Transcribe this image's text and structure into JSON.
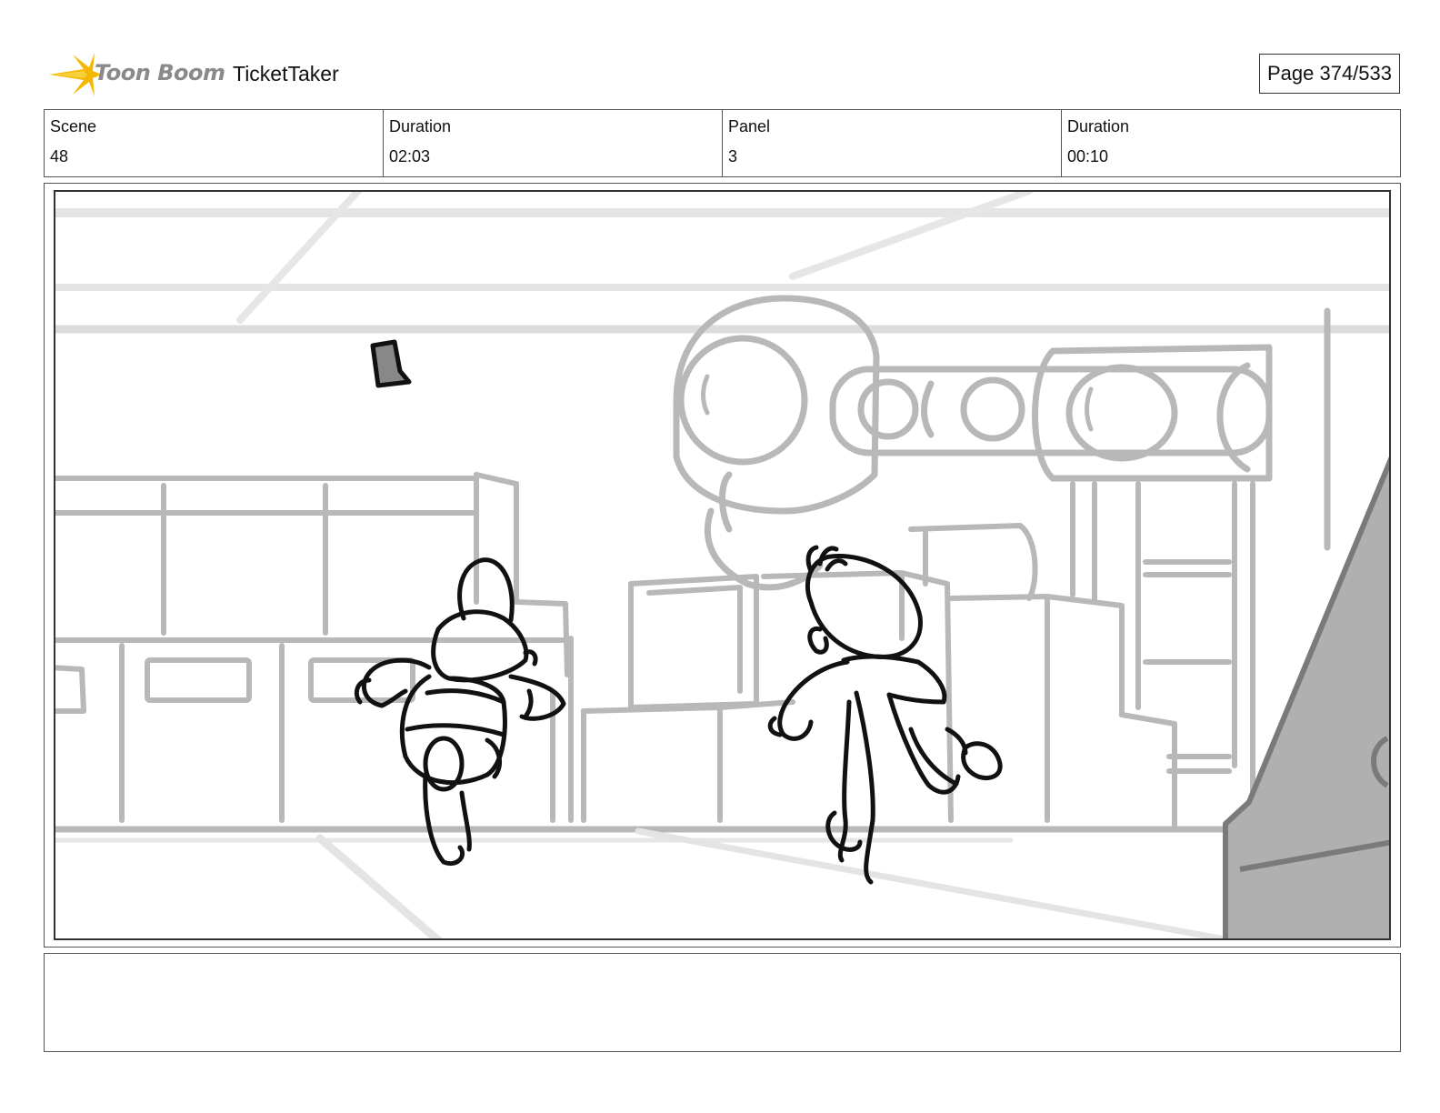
{
  "header": {
    "logo_text": "Toon Boom",
    "project_title": "TicketTaker",
    "page_label": "Page 374/533"
  },
  "info": {
    "scene_label": "Scene",
    "scene_value": "48",
    "scene_duration_label": "Duration",
    "scene_duration_value": "02:03",
    "panel_label": "Panel",
    "panel_value": "3",
    "panel_duration_label": "Duration",
    "panel_duration_value": "00:10"
  },
  "notes": {
    "text": ""
  },
  "colors": {
    "logo_star": "#f5b800",
    "logo_text": "#8a8a8a",
    "sketch_background": "#b8b8b8",
    "sketch_characters": "#111111",
    "foreground_shadow": "#b0b0b0"
  }
}
